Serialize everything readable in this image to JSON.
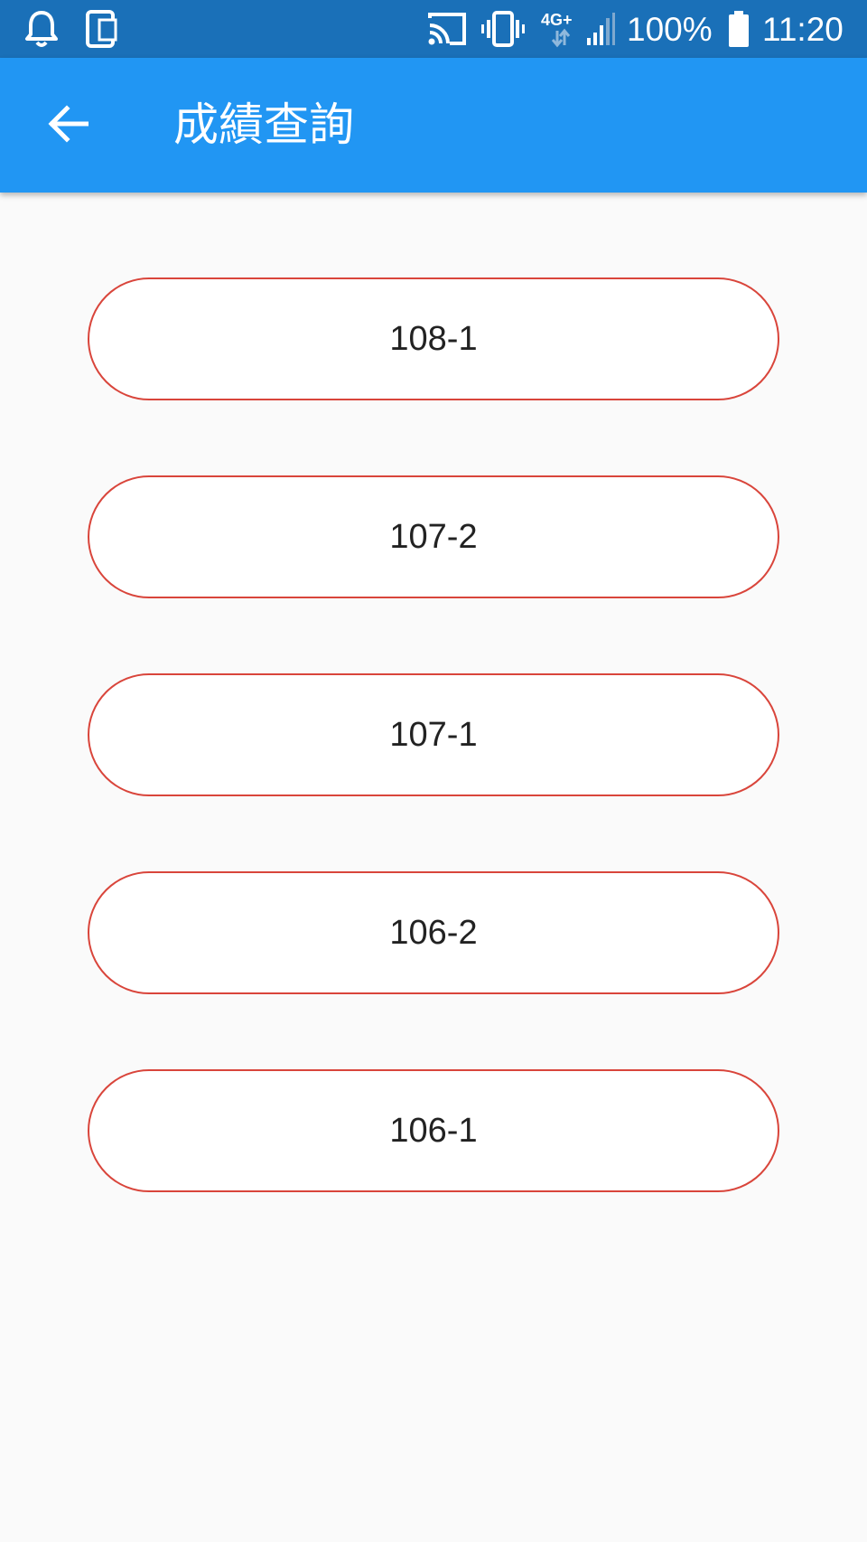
{
  "status_bar": {
    "battery": "100%",
    "time": "11:20",
    "network": "4G+",
    "icons": [
      "notification-bell-icon",
      "phone-rotate-icon",
      "cast-icon",
      "vibrate-icon",
      "network-4g-icon",
      "signal-icon",
      "battery-icon"
    ]
  },
  "app_bar": {
    "back_icon": "arrow-left-icon",
    "title": "成績查詢"
  },
  "semesters": [
    {
      "label": "108-1"
    },
    {
      "label": "107-2"
    },
    {
      "label": "107-1"
    },
    {
      "label": "106-2"
    },
    {
      "label": "106-1"
    }
  ],
  "colors": {
    "status_bar": "#1a70b8",
    "app_bar": "#2196f3",
    "button_border": "#d9453b",
    "background": "#fafafa"
  }
}
